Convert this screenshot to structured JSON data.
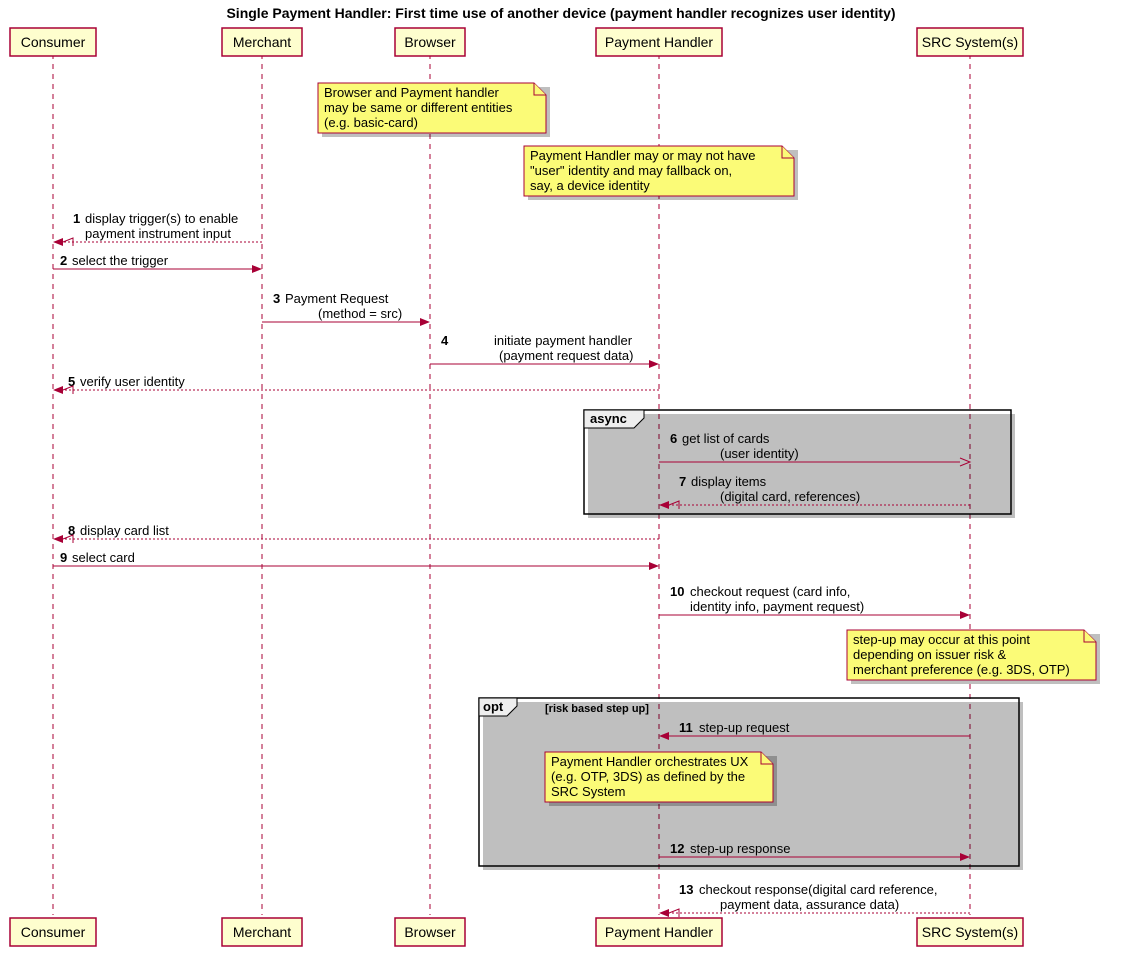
{
  "title": "Single Payment Handler: First time use of another device (payment handler recognizes user identity)",
  "participants": {
    "consumer": "Consumer",
    "merchant": "Merchant",
    "browser": "Browser",
    "ph": "Payment Handler",
    "src": "SRC System(s)"
  },
  "notes": {
    "note1_l1": "Browser and Payment handler",
    "note1_l2": "may be same or different entities",
    "note1_l3": "(e.g. basic-card)",
    "note2_l1": "Payment Handler may or may not have",
    "note2_l2": "\"user\" identity and may fallback on,",
    "note2_l3": "say, a device identity",
    "note3_l1": "step-up may occur at this point",
    "note3_l2": "depending on issuer risk &",
    "note3_l3": "merchant preference (e.g. 3DS, OTP)",
    "note4_l1": "Payment Handler orchestrates UX",
    "note4_l2": "(e.g. OTP, 3DS) as defined by the",
    "note4_l3": "SRC System"
  },
  "messages": {
    "m1_num": "1",
    "m1_l1": "display trigger(s) to enable",
    "m1_l2": "payment instrument input",
    "m2_num": "2",
    "m2": "select the trigger",
    "m3_num": "3",
    "m3_l1": "Payment Request",
    "m3_l2": "(method = src)",
    "m4_num": "4",
    "m4_l1": "initiate payment handler",
    "m4_l2": "(payment request data)",
    "m5_num": "5",
    "m5": "verify user identity",
    "m6_num": "6",
    "m6_l1": "get list of cards",
    "m6_l2": "(user identity)",
    "m7_num": "7",
    "m7_l1": "display items",
    "m7_l2": "(digital card, references)",
    "m8_num": "8",
    "m8": "display card list",
    "m9_num": "9",
    "m9": "select card",
    "m10_num": "10",
    "m10_l1": "checkout request (card info,",
    "m10_l2": "identity info, payment request)",
    "m11_num": "11",
    "m11": "step-up request",
    "m12_num": "12",
    "m12": "step-up response",
    "m13_num": "13",
    "m13_l1": "checkout response(digital card reference,",
    "m13_l2": "payment data, assurance data)"
  },
  "fragments": {
    "async": "async",
    "opt": "opt",
    "opt_guard": "[risk based step up]"
  }
}
